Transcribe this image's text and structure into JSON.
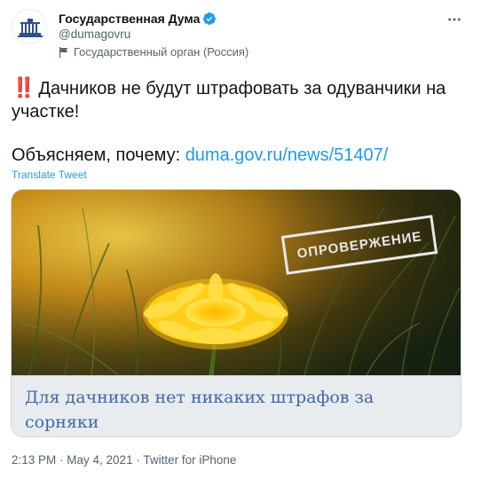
{
  "author": {
    "display_name": "Государственная Дума",
    "handle": "@dumagovru",
    "label": "Государственный орган (Россия)",
    "avatar_icon": "duma-building-icon",
    "verified_icon": "verified-badge-icon",
    "label_icon": "flag-icon"
  },
  "tweet": {
    "emoji": "‼️",
    "text_line1": "Дачников не будут штрафовать за одуванчики на участке!",
    "text_line2_prefix": "Объясняем, почему: ",
    "link": "duma.gov.ru/news/51407/",
    "translate_label": "Translate Tweet"
  },
  "card": {
    "image_icon": "dandelion-photo",
    "stamp_text": "ОПРОВЕРЖЕНИЕ",
    "headline": "Для дачников нет никаких штрафов за сорняки"
  },
  "meta": {
    "time": "2:13 PM",
    "separator": " · ",
    "date": "May 4, 2021",
    "source": "Twitter for iPhone"
  },
  "colors": {
    "accent": "#1d9bf0",
    "verified": "#1d9bf0",
    "headline": "#3e6aa8",
    "exclaim": "#e0242b"
  }
}
